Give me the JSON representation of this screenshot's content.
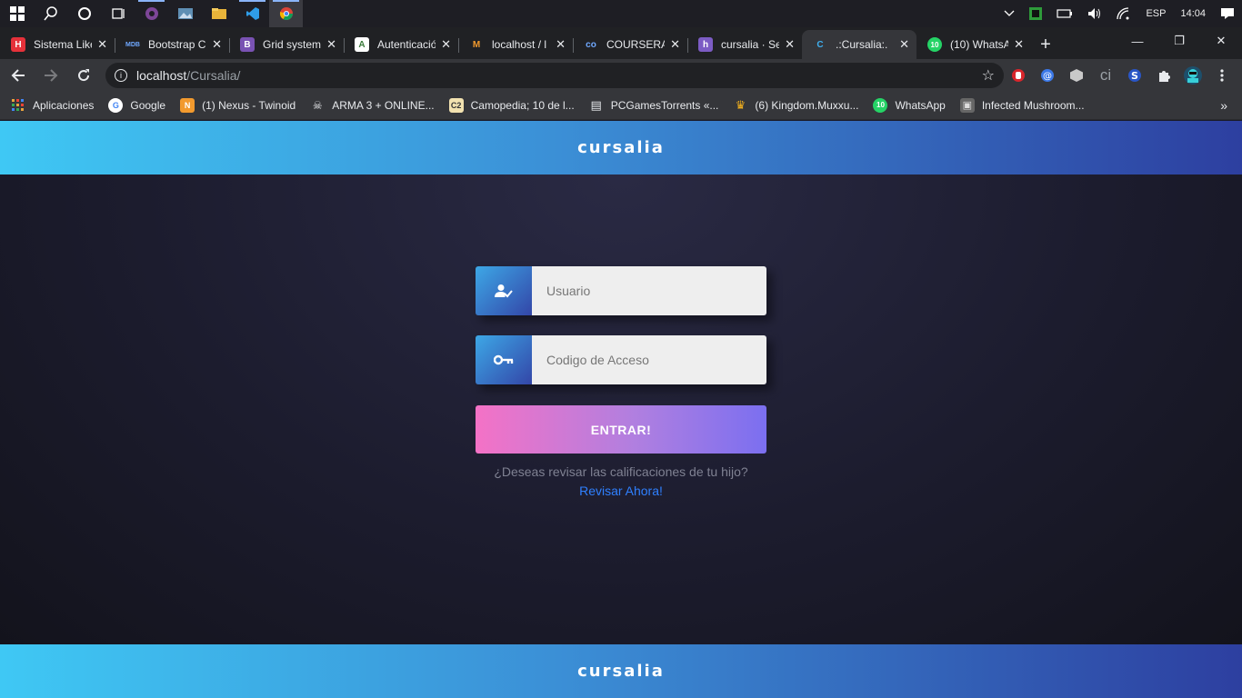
{
  "taskbar": {
    "language": "ESP",
    "time": "14:04"
  },
  "tabs": [
    {
      "title": "Sistema Like",
      "fav_bg": "#e5313a",
      "fav_text": "H"
    },
    {
      "title": "Bootstrap C",
      "fav_bg": "#202124",
      "fav_text": "MDB"
    },
    {
      "title": "Grid system",
      "fav_bg": "#7952b3",
      "fav_text": "B"
    },
    {
      "title": "Autenticació",
      "fav_bg": "#ffffff",
      "fav_text": "A"
    },
    {
      "title": "localhost / l",
      "fav_bg": "#202124",
      "fav_text": "M"
    },
    {
      "title": "COURSERA",
      "fav_bg": "#202124",
      "fav_text": "co"
    },
    {
      "title": "cursalia · Se",
      "fav_bg": "#7c5cc4",
      "fav_text": "h"
    },
    {
      "title": ".:Cursalia:.",
      "fav_bg": "#35363a",
      "fav_text": "C"
    },
    {
      "title": "(10) WhatsA",
      "fav_bg": "#25d366",
      "fav_text": "10"
    }
  ],
  "address_bar": {
    "host": "localhost",
    "path": "/Cursalia/"
  },
  "bookmarks": [
    {
      "label": "Aplicaciones",
      "color": "#e8a33d",
      "icon": "A"
    },
    {
      "label": "Google",
      "color": "#ffffff",
      "icon": "G"
    },
    {
      "label": "(1) Nexus - Twinoid",
      "color": "#f29a2e",
      "icon": "N"
    },
    {
      "label": "ARMA 3 + ONLINE...",
      "color": "#35363a",
      "icon": "☠"
    },
    {
      "label": "Camopedia; 10 de l...",
      "color": "#f2e2b0",
      "icon": "C2"
    },
    {
      "label": "PCGamesTorrents «...",
      "color": "#35363a",
      "icon": "▤"
    },
    {
      "label": "(6) Kingdom.Muxxu...",
      "color": "#35363a",
      "icon": "♛"
    },
    {
      "label": "WhatsApp",
      "color": "#25d366",
      "icon": "10"
    },
    {
      "label": "Infected Mushroom...",
      "color": "#666666",
      "icon": "▣"
    }
  ],
  "page": {
    "logo": "cursalia",
    "username_placeholder": "Usuario",
    "access_code_placeholder": "Codigo de Acceso",
    "enter_button": "ENTRAR!",
    "question": "¿Deseas revisar las calificaciones de tu hijo?",
    "review_link": "Revisar Ahora!"
  }
}
